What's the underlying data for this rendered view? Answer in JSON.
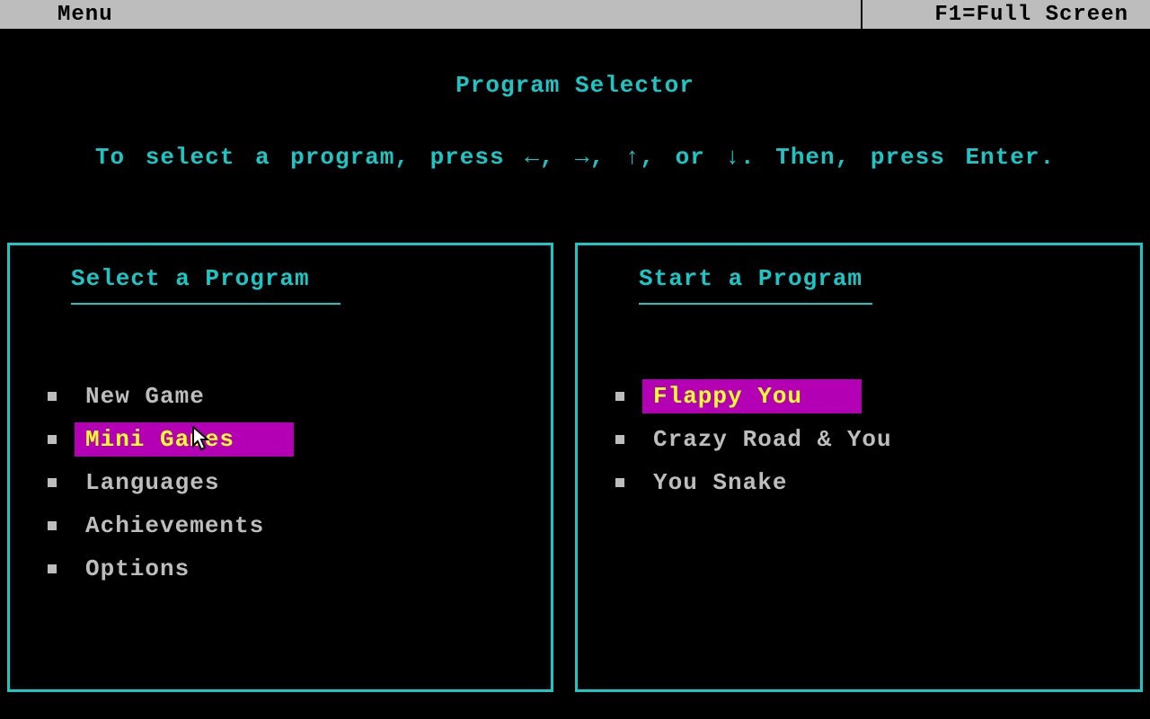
{
  "menubar": {
    "menu": "Menu",
    "full": "F1=Full Screen"
  },
  "title": "Program Selector",
  "hint": "To select a program, press ←, →, ↑, or ↓. Then, press Enter.",
  "panels": {
    "left": {
      "title": "Select a Program",
      "items": [
        "New Game",
        "Mini Games",
        "Languages",
        "Achievements",
        "Options"
      ],
      "highlight": 1
    },
    "right": {
      "title": "Start a Program",
      "items": [
        "Flappy You",
        "Crazy Road & You",
        "You Snake"
      ],
      "highlight": 0
    }
  }
}
